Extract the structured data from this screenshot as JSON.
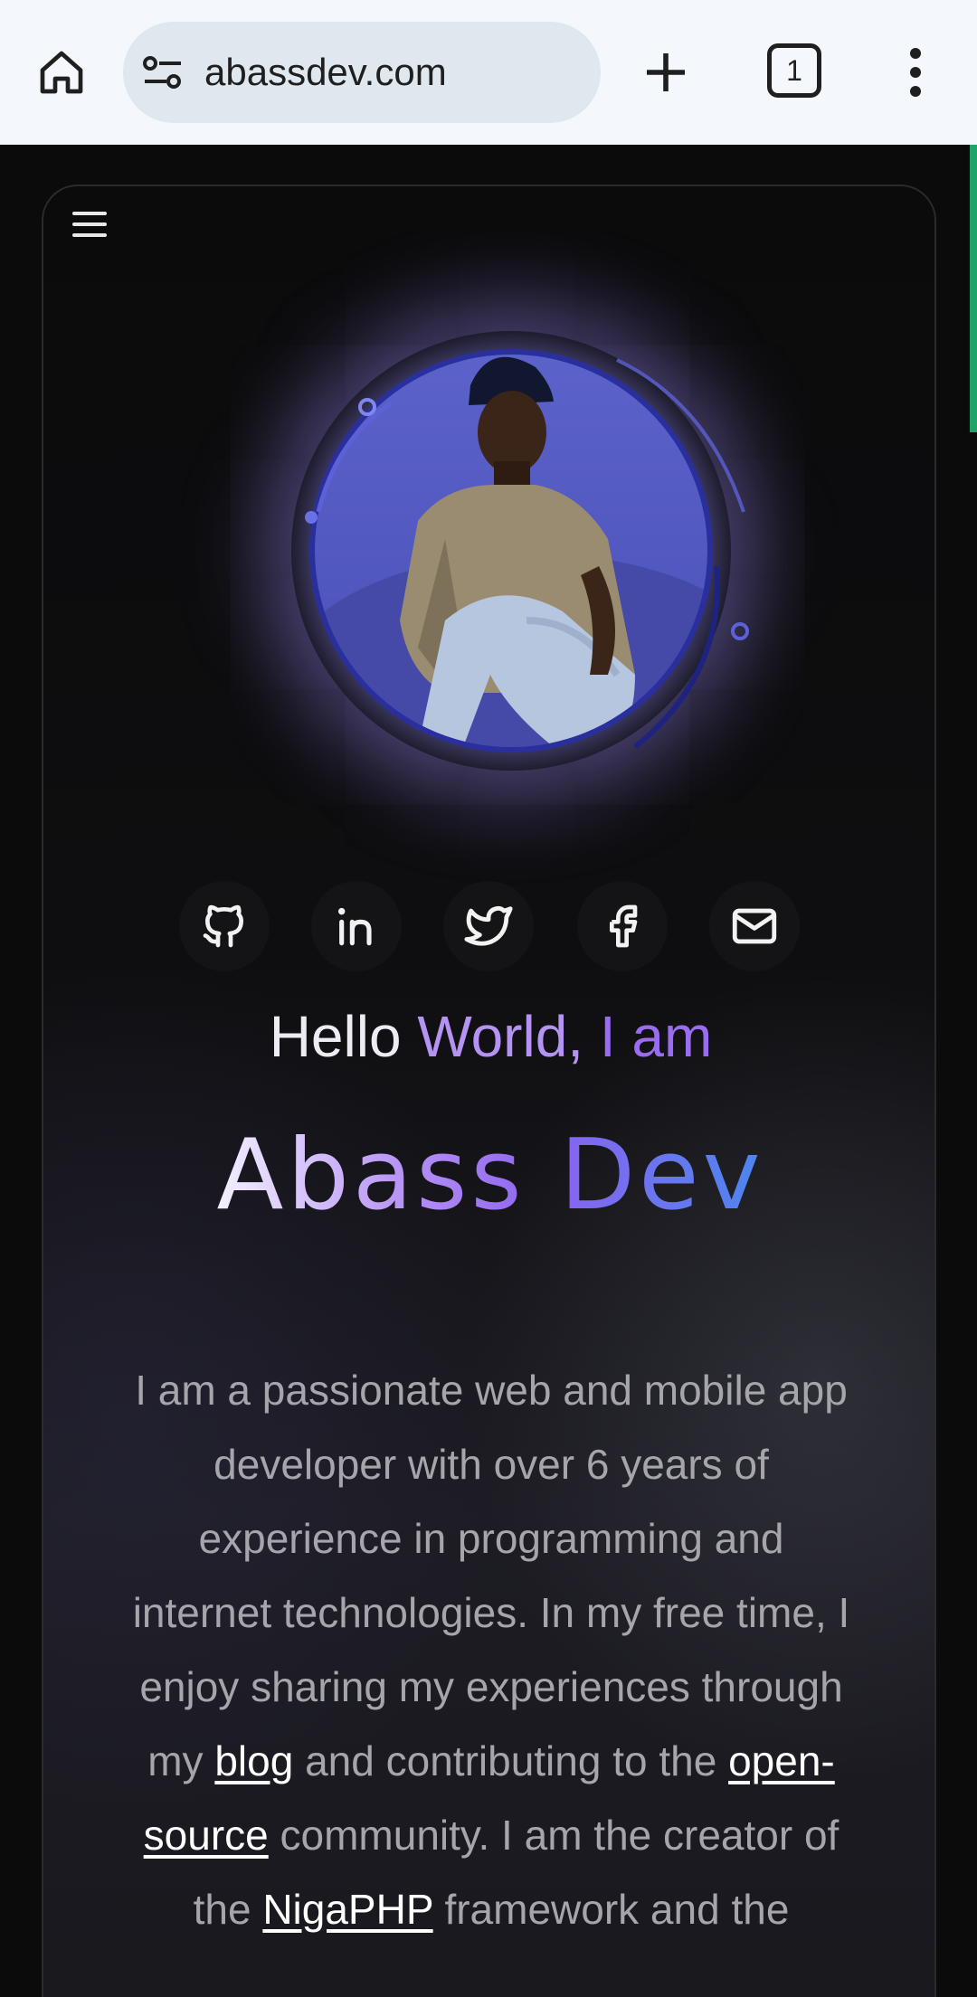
{
  "browser": {
    "url": "abassdev.com",
    "tab_count": "1"
  },
  "hero": {
    "hello": "Hello",
    "world": "World,",
    "i_am": "I am",
    "name_part1": "Abass",
    "name_part2": "Dev"
  },
  "socials": [
    {
      "name": "GitHub",
      "icon": "github-icon"
    },
    {
      "name": "LinkedIn",
      "icon": "linkedin-icon"
    },
    {
      "name": "Twitter",
      "icon": "twitter-icon"
    },
    {
      "name": "Facebook",
      "icon": "facebook-icon"
    },
    {
      "name": "Email",
      "icon": "mail-icon"
    }
  ],
  "bio": {
    "part1": "I am a passionate web and mobile app developer with over 6 years of experience in programming and internet technologies. In my free time, I enjoy sharing my experiences through my ",
    "blog_link": "blog",
    "part2": " and contributing to the ",
    "opensource_link": "open-source",
    "part3": " community. I am the creator of the ",
    "nigaphp_link": "NigaPHP",
    "part4": " framework and the"
  },
  "colors": {
    "accent_purple": "#b493f2",
    "accent_blue": "#5b8ef0",
    "scroll_indicator": "#1fa36b"
  }
}
